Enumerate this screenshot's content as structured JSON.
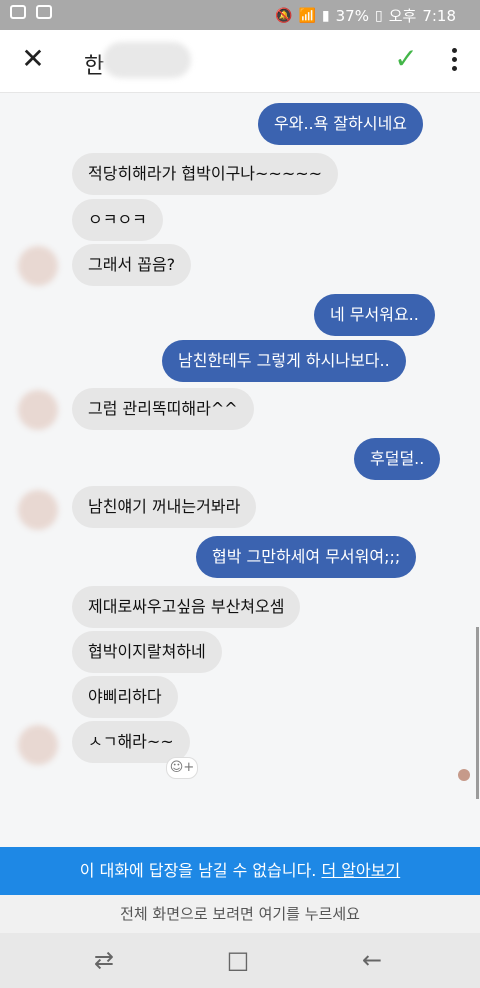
{
  "status_bar": {
    "battery": "37%",
    "ampm": "오후",
    "time": "7:18",
    "icons": [
      "notification-icon",
      "image-icon",
      "mute-icon",
      "wifi-icon",
      "signal-icon",
      "battery-icon"
    ]
  },
  "header": {
    "close_icon": "close-icon",
    "title": "한",
    "confirm_icon": "check-icon",
    "menu_icon": "more-icon"
  },
  "messages": [
    {
      "from": "me",
      "text": "우와..욕 잘하시네요"
    },
    {
      "from": "other",
      "text": "적당히해라가 협박이구나~~~~~"
    },
    {
      "from": "other",
      "text": "ㅇㅋㅇㅋ"
    },
    {
      "from": "other",
      "text": "그래서 꼽음?"
    },
    {
      "from": "me",
      "text": "네 무서워요.."
    },
    {
      "from": "me",
      "text": "남친한테두 그렇게 하시나보다.."
    },
    {
      "from": "other",
      "text": "그럼 관리똑띠해라^^"
    },
    {
      "from": "me",
      "text": "후덜덜.."
    },
    {
      "from": "other",
      "text": "남친얘기 꺼내는거봐라"
    },
    {
      "from": "me",
      "text": "협박 그만하세여 무서워여;;;"
    },
    {
      "from": "other",
      "text": "제대로싸우고싶음 부산쳐오셈"
    },
    {
      "from": "other",
      "text": "협박이지랄쳐하네"
    },
    {
      "from": "other",
      "text": "야삐리하다"
    },
    {
      "from": "other",
      "text": "ㅅㄱ해라~~"
    }
  ],
  "reaction_button": "☺+",
  "notice": {
    "text": "이 대화에 답장을 남길 수 없습니다.",
    "link": "더 알아보기"
  },
  "fullscreen_hint": "전체 화면으로 보려면 여기를 누르세요",
  "nav": {
    "recent": "⇄",
    "home": "□",
    "back": "←"
  },
  "colors": {
    "outgoing_bubble": "#3b63b0",
    "incoming_bubble": "#e6e6e6",
    "notice_bar": "#1e88e5",
    "check": "#43b649"
  }
}
